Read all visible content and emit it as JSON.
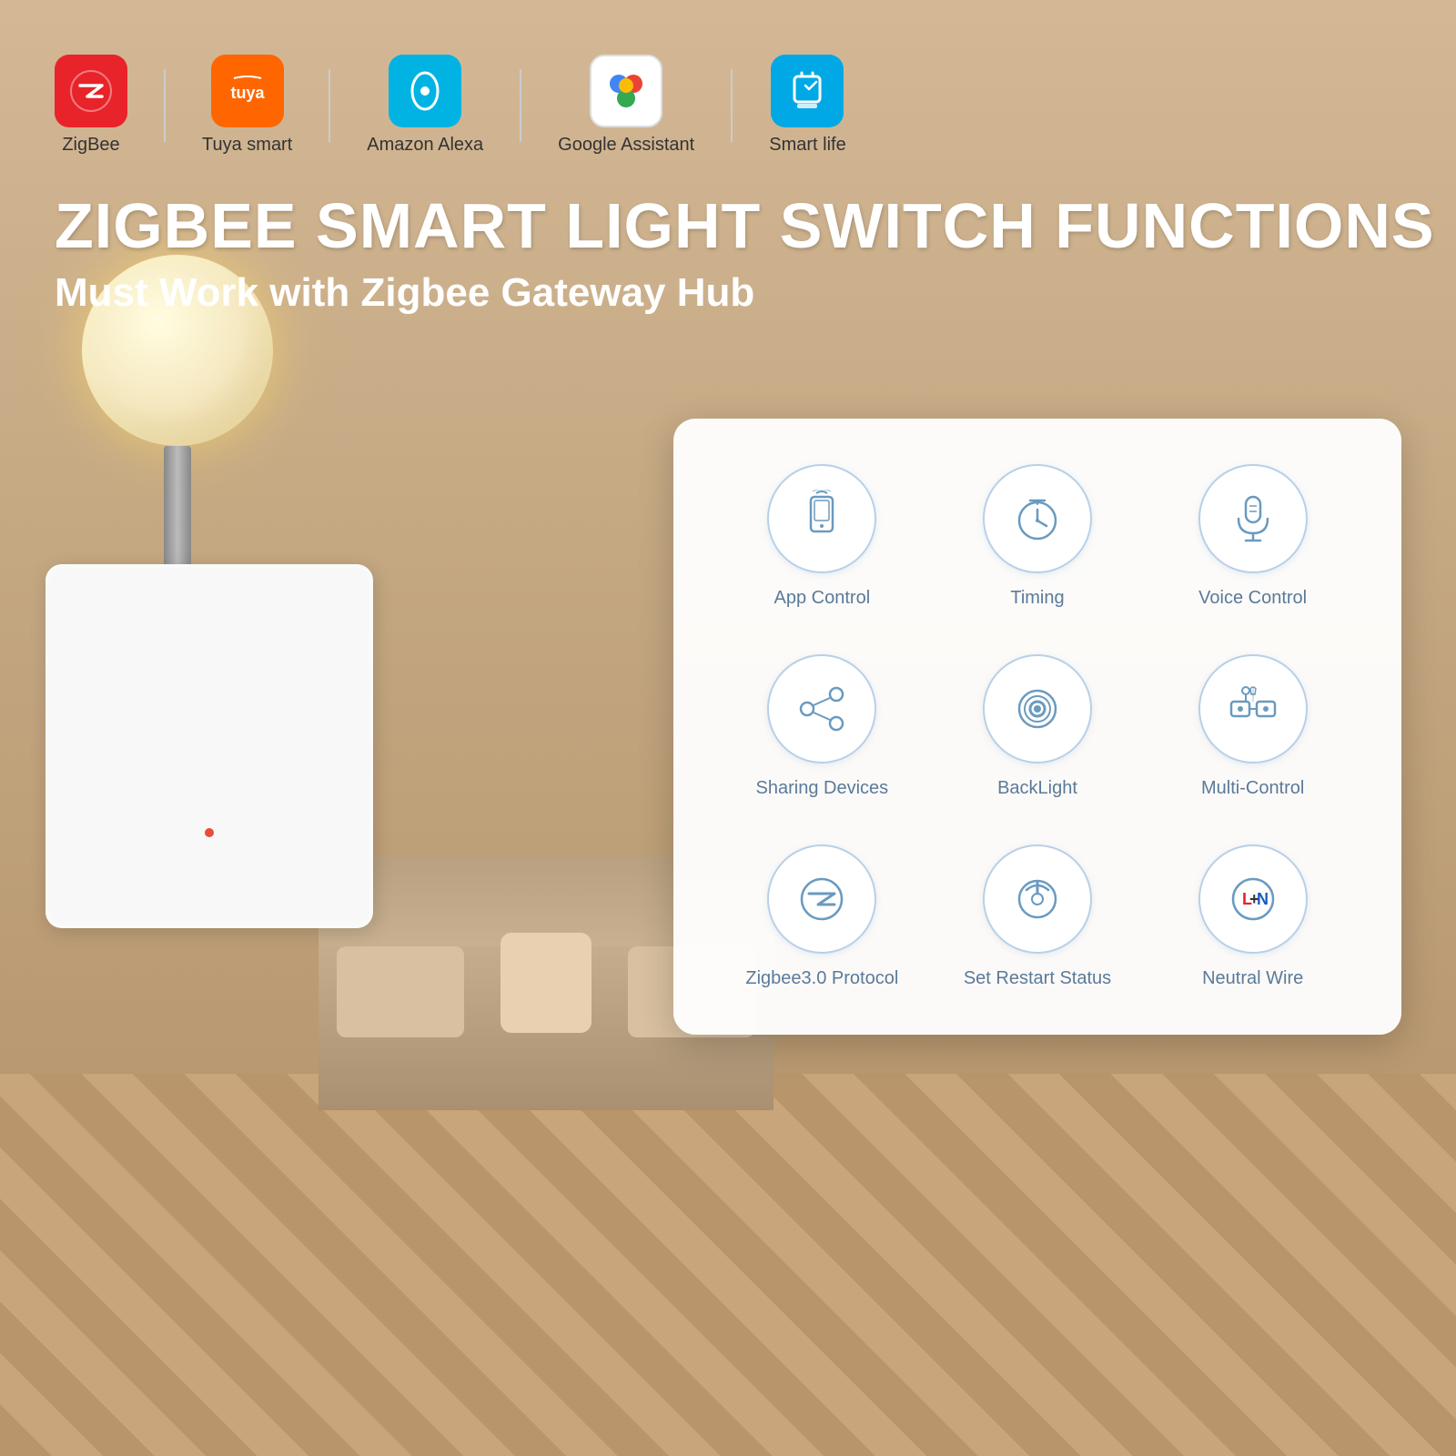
{
  "brands": [
    {
      "id": "zigbee",
      "label": "ZigBee",
      "color": "#e8232a",
      "icon": "zigbee"
    },
    {
      "id": "tuya",
      "label": "Tuya smart",
      "color": "#ff6600",
      "icon": "tuya"
    },
    {
      "id": "alexa",
      "label": "Amazon Alexa",
      "color": "#00b3e3",
      "icon": "alexa"
    },
    {
      "id": "google",
      "label": "Google Assistant",
      "color": "#4285f4",
      "icon": "google"
    },
    {
      "id": "smartlife",
      "label": "Smart life",
      "color": "#00a8e6",
      "icon": "smartlife"
    }
  ],
  "title": {
    "line1": "ZIGBEE SMART LIGHT SWITCH FUNCTIONS",
    "line2": "Must Work with Zigbee Gateway Hub"
  },
  "features": [
    {
      "id": "app-control",
      "label": "App Control",
      "icon": "phone-wifi"
    },
    {
      "id": "timing",
      "label": "Timing",
      "icon": "clock"
    },
    {
      "id": "voice-control",
      "label": "Voice Control",
      "icon": "microphone"
    },
    {
      "id": "sharing-devices",
      "label": "Sharing Devices",
      "icon": "share"
    },
    {
      "id": "backlight",
      "label": "BackLight",
      "icon": "backlight"
    },
    {
      "id": "multi-control",
      "label": "Multi-Control",
      "icon": "multi"
    },
    {
      "id": "zigbee-protocol",
      "label": "Zigbee3.0 Protocol",
      "icon": "zigbee-logo"
    },
    {
      "id": "set-restart",
      "label": "Set Restart Status",
      "icon": "power"
    },
    {
      "id": "neutral-wire",
      "label": "Neutral Wire",
      "icon": "ln"
    }
  ]
}
